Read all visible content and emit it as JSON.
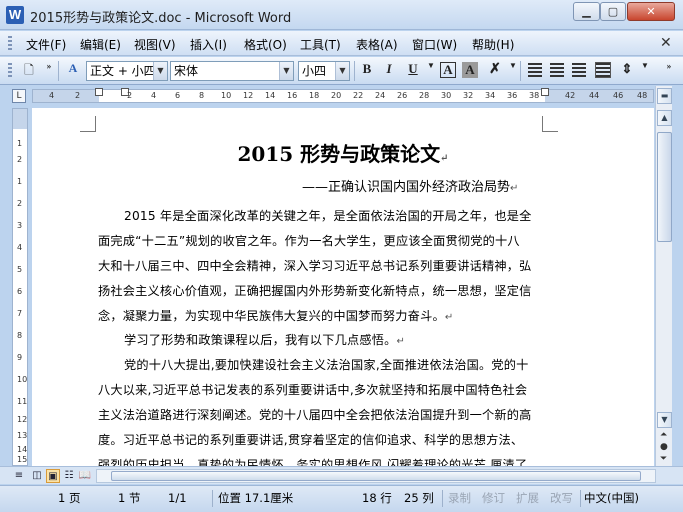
{
  "window": {
    "title": "2015形势与政策论文.doc - Microsoft Word"
  },
  "menu": [
    "文件(F)",
    "编辑(E)",
    "视图(V)",
    "插入(I)",
    "格式(O)",
    "工具(T)",
    "表格(A)",
    "窗口(W)",
    "帮助(H)"
  ],
  "toolbar": {
    "style_value": "正文 + 小四",
    "font_value": "宋体",
    "size_value": "小四",
    "bold_label": "B",
    "italic_label": "I",
    "underline_label": "U",
    "char_border_label": "A",
    "char_shade_label": "A"
  },
  "ruler": {
    "ticks": [
      "4",
      "2",
      "2",
      "4",
      "6",
      "8",
      "10",
      "12",
      "14",
      "16",
      "18",
      "20",
      "22",
      "24",
      "26",
      "28",
      "30",
      "32",
      "34",
      "36",
      "38",
      "42",
      "44",
      "46",
      "48"
    ]
  },
  "vruler": {
    "ticks": [
      "1",
      "2",
      "1",
      "2",
      "3",
      "4",
      "5",
      "6",
      "7",
      "8",
      "9",
      "10",
      "11",
      "12",
      "13",
      "14",
      "15"
    ]
  },
  "document": {
    "title": "2015 形势与政策论文",
    "subtitle": "——正确认识国内国外经济政治局势",
    "lines": [
      "2015 年是全面深化改革的关键之年，是全面依法治国的开局之年，也是全",
      "面完成“十二五”规划的收官之年。作为一名大学生，更应该全面贯彻党的十八",
      "大和十八届三中、四中全会精神，深入学习习近平总书记系列重要讲话精神，弘",
      "扬社会主义核心价值观，正确把握国内外形势新变化新特点，统一思想，坚定信",
      "念，凝聚力量，为实现中华民族伟大复兴的中国梦而努力奋斗。",
      "学习了形势和政策课程以后，我有以下几点感悟。",
      "党的十八大提出,要加快建设社会主义法治国家,全面推进依法治国。党的十",
      "八大以来,习近平总书记发表的系列重要讲话中,多次就坚持和拓展中国特色社会",
      "主义法治道路进行深刻阐述。党的十八届四中全会把依法治国提升到一个新的高",
      "度。习近平总书记的系列重要讲话,贯穿着坚定的信仰追求、科学的思想方法、",
      "强烈的历史担当、真挚的为民情怀、务实的思想作风,闪耀着理论的光芒,厘清了"
    ]
  },
  "status": {
    "page": "1 页",
    "section": "1 节",
    "page_of": "1/1",
    "position": "位置 17.1厘米",
    "line": "18 行",
    "col": "25 列",
    "rec": "录制",
    "trk": "修订",
    "ext": "扩展",
    "ovr": "改写",
    "lang": "中文(中国)"
  }
}
